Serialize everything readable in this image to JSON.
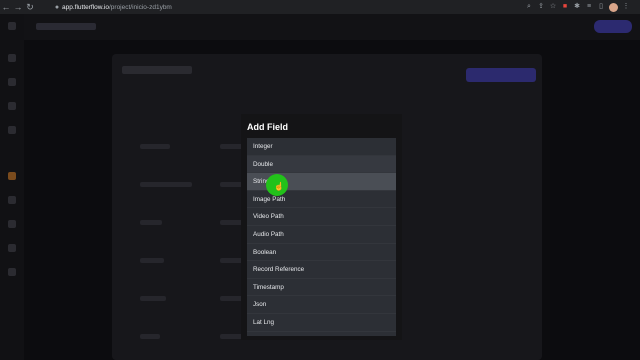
{
  "browser": {
    "url_host": "app.flutterflow.io",
    "url_path": "/project/inicio-zd1ybm",
    "nav_back": "←",
    "nav_forward": "→",
    "nav_reload": "↻",
    "lock": "🔒",
    "ext_icons": [
      "search-icon",
      "share-icon",
      "star-icon",
      "extension-icon",
      "puzzle-icon",
      "menu-icon",
      "sidebar-icon"
    ]
  },
  "modal": {
    "title": "Add Field",
    "items": [
      {
        "label": "Integer"
      },
      {
        "label": "Double"
      },
      {
        "label": "String"
      },
      {
        "label": "Image Path"
      },
      {
        "label": "Video Path"
      },
      {
        "label": "Audio Path"
      },
      {
        "label": "Boolean"
      },
      {
        "label": "Record Reference"
      },
      {
        "label": "Timestamp"
      },
      {
        "label": "Json"
      },
      {
        "label": "Lat Lng"
      }
    ],
    "hovered_item": "String"
  },
  "colors": {
    "modal_bg": "#141416",
    "list_bg": "#2c2f35",
    "hover_bg": "#4a4e55",
    "cursor_highlight": "#22c21a",
    "accent": "#2c2a6e"
  }
}
